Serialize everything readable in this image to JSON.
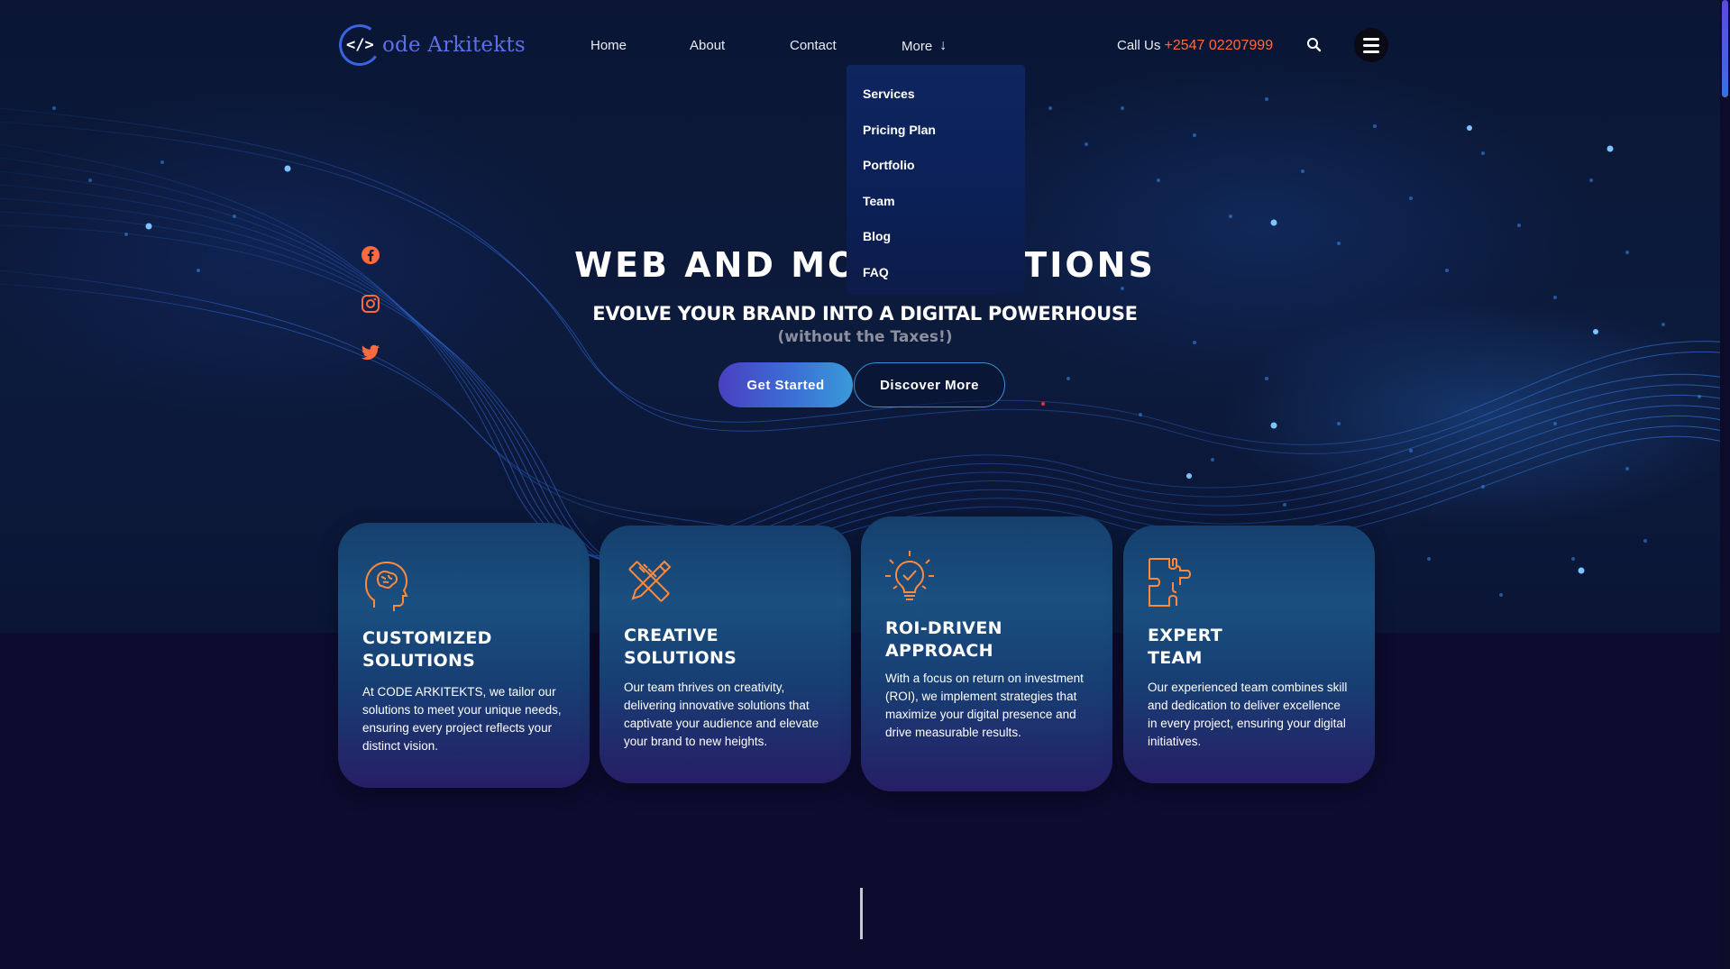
{
  "brand": {
    "logo_mark": "</>",
    "name": "ode Arkitekts"
  },
  "nav": {
    "home": "Home",
    "about": "About",
    "contact": "Contact",
    "more": "More",
    "more_arrow": "↓"
  },
  "header": {
    "call_label": "Call Us",
    "phone": "+2547 02207999",
    "search_icon": "search-icon",
    "menu_icon": "hamburger-icon"
  },
  "dropdown": {
    "items": [
      "Services",
      "Pricing Plan",
      "Portfolio",
      "Team",
      "Blog",
      "FAQ"
    ]
  },
  "social": [
    "facebook-icon",
    "instagram-icon",
    "twitter-icon"
  ],
  "hero": {
    "title_left": "WEB AND MOB",
    "title_right": "TIONS",
    "subtitle": "EVOLVE YOUR BRAND INTO A DIGITAL POWERHOUSE",
    "tagline": "(without the Taxes!)",
    "primary_button": "Get Started",
    "secondary_button": "Discover More"
  },
  "features": [
    {
      "icon": "brain-head-icon",
      "title_line1": "CUSTOMIZED",
      "title_line2": "SOLUTIONS",
      "text": "At CODE ARKITEKTS, we tailor our solutions to meet your unique needs, ensuring every project reflects your distinct vision."
    },
    {
      "icon": "pencil-ruler-icon",
      "title_line1": "CREATIVE",
      "title_line2": "SOLUTIONS",
      "text": "Our team thrives on creativity, delivering innovative solutions that captivate your audience and elevate your brand to new heights."
    },
    {
      "icon": "lightbulb-check-icon",
      "title_line1": "ROI-DRIVEN",
      "title_line2": "APPROACH",
      "text": "With a focus on return on investment (ROI), we implement strategies that maximize your digital presence and drive measurable results."
    },
    {
      "icon": "puzzle-icon",
      "title_line1": "EXPERT",
      "title_line2": "TEAM",
      "text": "Our experienced team combines skill and dedication to deliver excellence in every project, ensuring your digital initiatives."
    }
  ],
  "colors": {
    "accent_orange": "#ff6a3d",
    "brand_blue": "#5b6fe6",
    "background": "#0b0a2a"
  }
}
